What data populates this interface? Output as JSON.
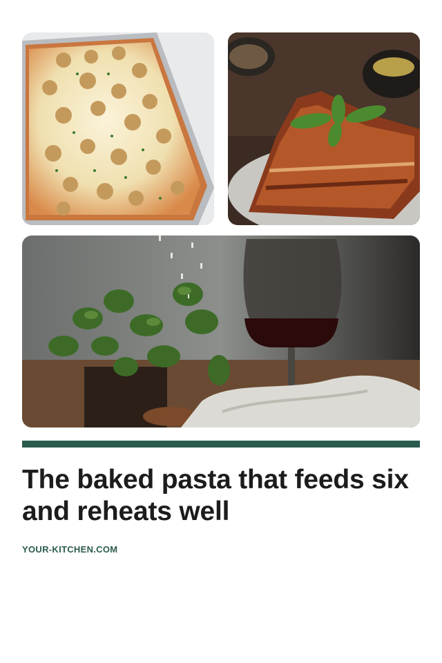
{
  "card": {
    "headline": "The baked pasta that feeds six and reheats well",
    "source": "YOUR-KITCHEN.COM",
    "accent_color": "#2b5b4e"
  },
  "images": [
    {
      "name": "baked-pasta-tray-photo",
      "description": ""
    },
    {
      "name": "lasagna-slice-photo",
      "description": ""
    },
    {
      "name": "basil-and-wine-photo",
      "description": ""
    }
  ]
}
